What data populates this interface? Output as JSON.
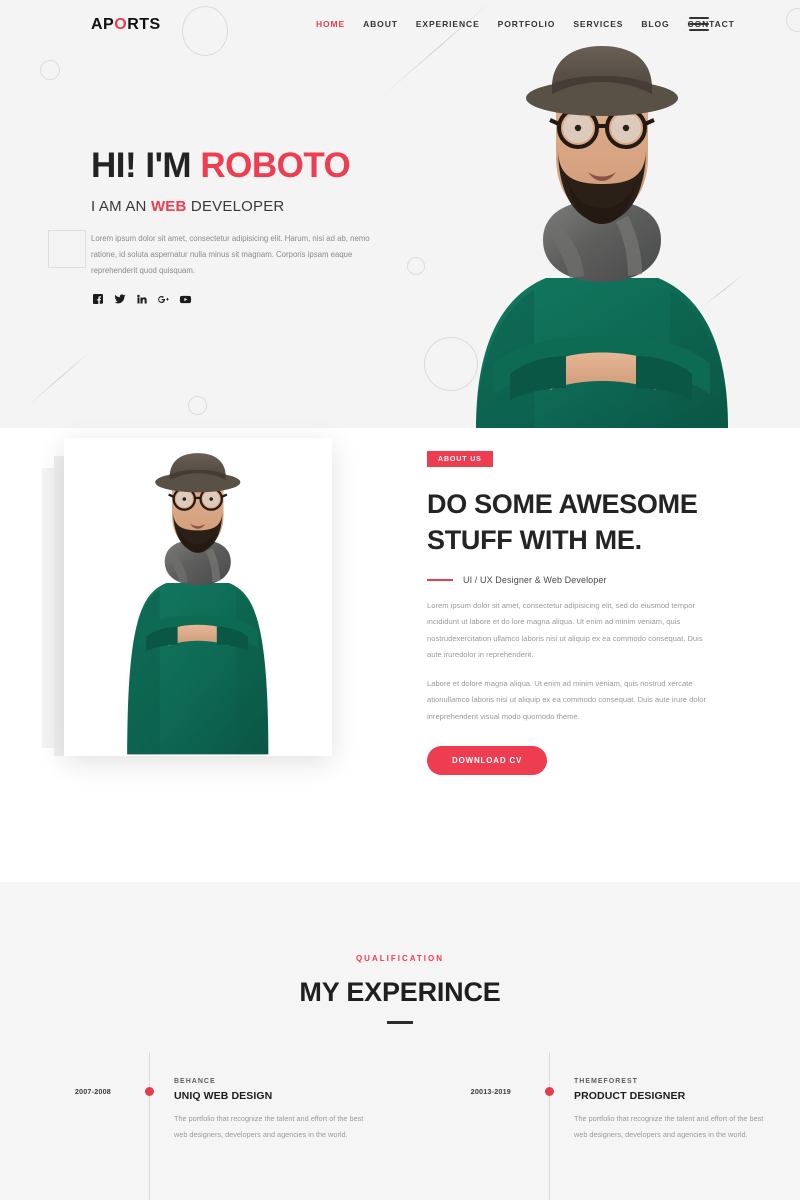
{
  "header": {
    "logo_before": "AP",
    "logo_accent": "O",
    "logo_after": "RTS",
    "nav": [
      {
        "label": "HOME",
        "active": true
      },
      {
        "label": "ABOUT",
        "active": false
      },
      {
        "label": "EXPERIENCE",
        "active": false
      },
      {
        "label": "PORTFOLIO",
        "active": false
      },
      {
        "label": "SERVICES",
        "active": false
      },
      {
        "label": "BLOG",
        "active": false
      },
      {
        "label": "CONTACT",
        "active": false
      }
    ],
    "menu_icon": "hamburger-icon"
  },
  "hero": {
    "title_prefix": "HI! I'M ",
    "title_accent": "ROBOTO",
    "sub_prefix": "I AM AN ",
    "sub_accent": "WEB",
    "sub_suffix": " DEVELOPER",
    "paragraph": "Lorem ipsum dolor sit amet, consectetur adipisicing elit. Harum, nisi ad ab, nemo ratione, id soluta aspernatur nulla minus sit magnam. Corporis ipsam eaque reprehenderit quod quisquam.",
    "socials": [
      {
        "name": "facebook-icon"
      },
      {
        "name": "twitter-icon"
      },
      {
        "name": "linkedin-icon"
      },
      {
        "name": "google-plus-icon"
      },
      {
        "name": "youtube-icon"
      }
    ],
    "portrait_alt": "bearded man with hat glasses scarf green sweater arms crossed"
  },
  "about": {
    "badge": "ABOUT US",
    "heading_line1": "DO SOME AWESOME",
    "heading_line2": "STUFF WITH ME.",
    "subline": "UI / UX Designer & Web Developer",
    "paragraph1": "Lorem ipsum dolor sit amet, consectetur adipisicing elit, sed do eiusmod tempor incididunt ut labore et do lore magna aliqua. Ut enim ad minim veniam, quis nostrudexercitation ullamco laboris nisi ut aliquip ex ea commodo consequat. Duis aute iruredolor in reprehenderit.",
    "paragraph2": "Labore et dolore magna aliqua. Ut enim ad minim veniam, quis nostrud xercate ationullamco laboris nisi ut aliquip ex ea commodo consequat. Duis aute irure dolor inreprehenderit visual modo quomodo theme.",
    "cta_label": "DOWNLOAD CV",
    "portrait_alt": "bearded man with hat glasses scarf green sweater arms crossed"
  },
  "qualification": {
    "kicker": "QUALIFICATION",
    "title": "MY EXPERINCE",
    "items": [
      {
        "date": "2007-2008",
        "org": "BEHANCE",
        "role": "UNIQ WEB DESIGN",
        "desc": "The portfolio that recognize the talent and effort of the best web designers, developers and agencies in the world."
      },
      {
        "date": "20013-2019",
        "org": "THEMEFOREST",
        "role": "PRODUCT DESIGNER",
        "desc": "The portfolio that recognize the talent and effort of the best web designers, developers and agencies in the world."
      }
    ]
  },
  "colors": {
    "accent": "#ee3c50",
    "hero_bg": "#f4f4f4",
    "section_bg": "#f5f5f5",
    "body_bg": "#ffffff",
    "heading": "#222222",
    "muted_text": "#9a9a9a"
  }
}
